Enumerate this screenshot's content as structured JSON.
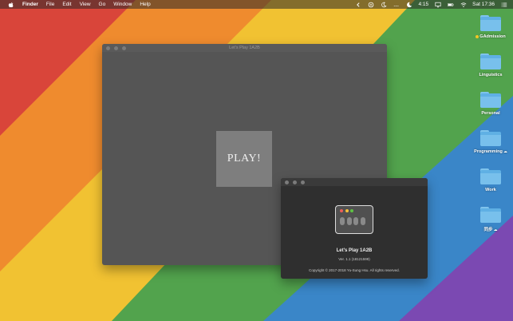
{
  "menubar": {
    "apple_icon": "apple-icon",
    "app_name": "Finder",
    "items": [
      "File",
      "Edit",
      "View",
      "Go",
      "Window",
      "Help"
    ],
    "battery_time": "4:15",
    "clock": "Sat 17:36"
  },
  "main_window": {
    "title": "Let's Play 1A2B",
    "play_label": "PLAY!"
  },
  "about_window": {
    "app_name": "Let's Play 1A2B",
    "version": "Ver. 1.1 (18121599)",
    "copyright": "Copyright © 2017-2018 Yu-Sung Hsu. All rights reserved."
  },
  "desktop": {
    "items": [
      {
        "label": "GAdmission"
      },
      {
        "label": "Linguistics"
      },
      {
        "label": "Personal"
      },
      {
        "label": "Programming"
      },
      {
        "label": "Work"
      },
      {
        "label": "同步"
      }
    ]
  },
  "colors": {
    "stripe_red": "#d9453a",
    "stripe_orange": "#ef8b2e",
    "stripe_yellow": "#f1c232",
    "stripe_green": "#52a34d",
    "stripe_blue": "#3a86c8",
    "stripe_purple": "#7b49b2",
    "tag_yellow": "#f3c623"
  }
}
